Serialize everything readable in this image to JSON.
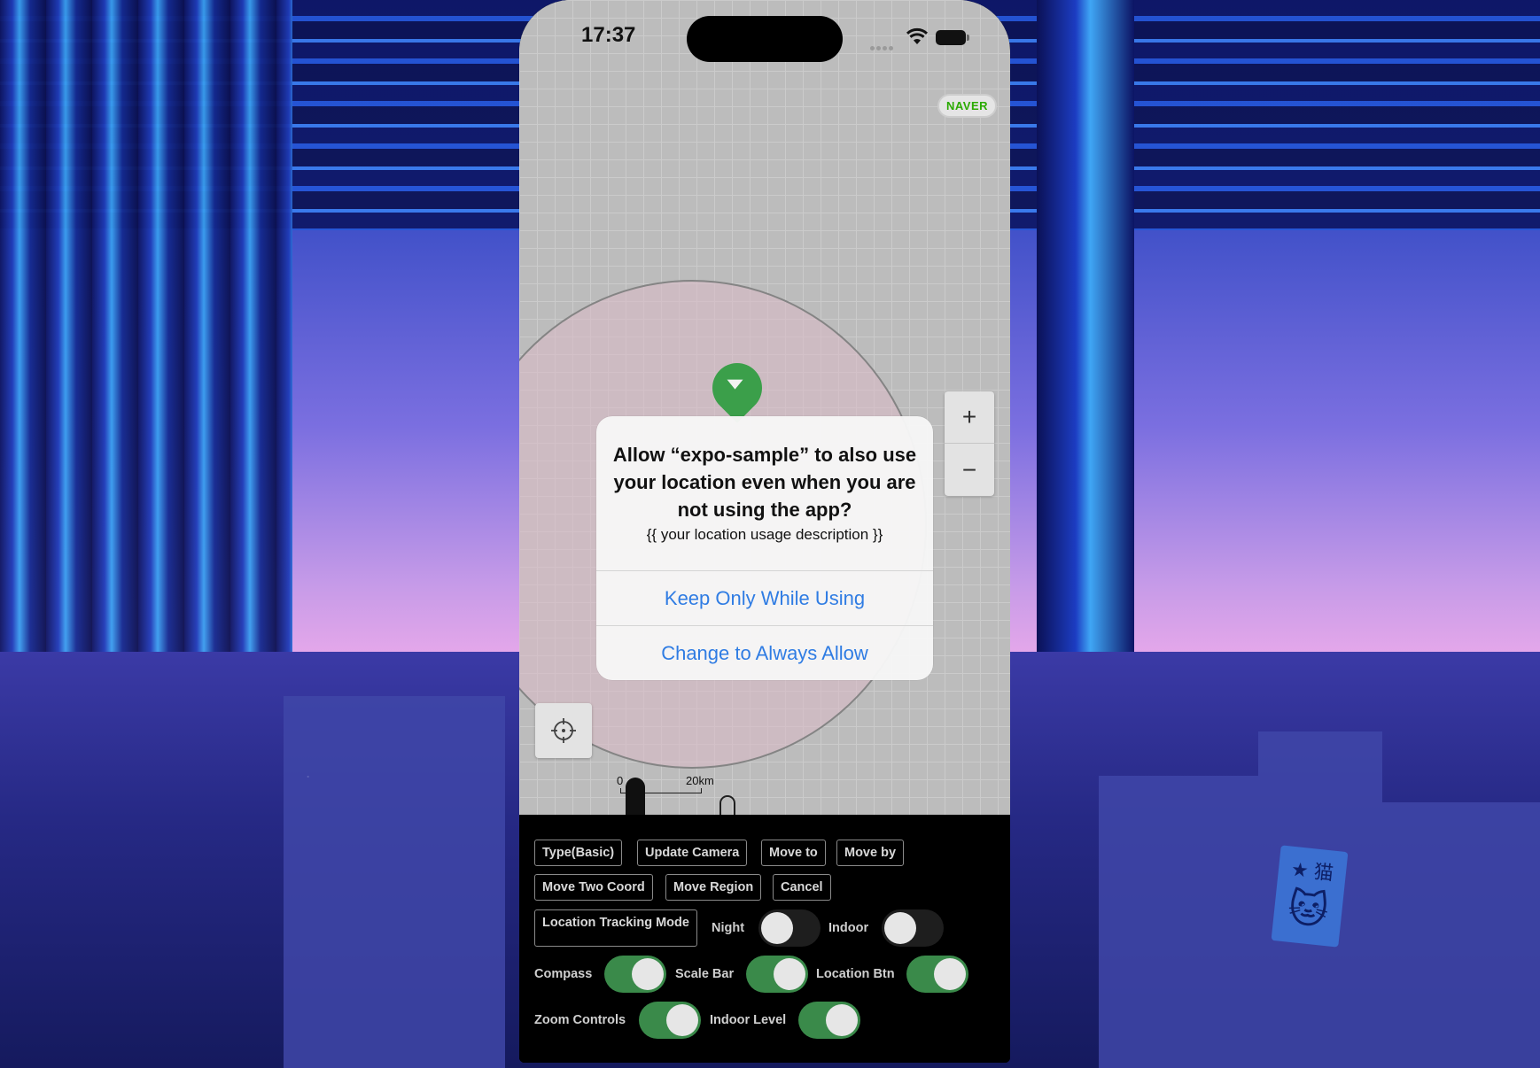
{
  "status_bar": {
    "time": "17:37"
  },
  "map": {
    "logo": "NAVER",
    "zoom_in": "+",
    "zoom_out": "−",
    "scale": {
      "min": "0",
      "max": "20km"
    }
  },
  "dialog": {
    "title": "Allow “expo-sample” to also use your location even when you are not using the app?",
    "message": "{{ your location usage description }}",
    "button_keep": "Keep Only While Using",
    "button_always": "Change to Always Allow",
    "accent_color": "#2f7ce3"
  },
  "controls": {
    "buttons": {
      "type_basic": "Type(Basic)",
      "update_camera": "Update Camera",
      "move_to": "Move to",
      "move_by": "Move by",
      "move_two_coord": "Move Two Coord",
      "move_region": "Move Region",
      "cancel": "Cancel",
      "location_tracking_mode": "Location Tracking Mode"
    },
    "toggles": {
      "night": {
        "label": "Night",
        "on": false
      },
      "indoor": {
        "label": "Indoor",
        "on": false
      },
      "compass": {
        "label": "Compass",
        "on": true
      },
      "scale_bar": {
        "label": "Scale Bar",
        "on": true
      },
      "location_btn": {
        "label": "Location Btn",
        "on": true
      },
      "zoom_controls": {
        "label": "Zoom Controls",
        "on": true
      },
      "indoor_level": {
        "label": "Indoor Level",
        "on": true
      }
    },
    "toggle_on_color": "#3a8a4a"
  },
  "wallpaper": {
    "sticker_text": "★ 猫"
  }
}
